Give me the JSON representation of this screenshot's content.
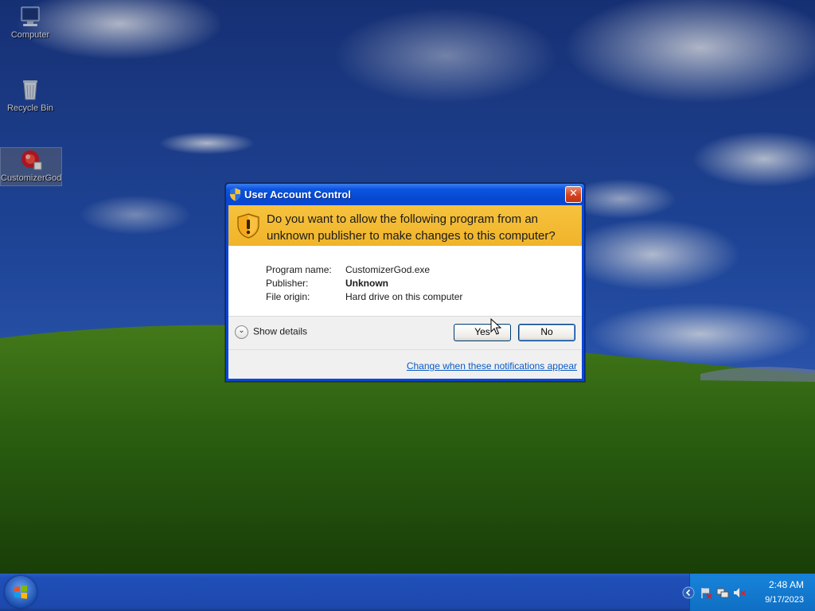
{
  "desktop": {
    "icons": [
      {
        "label": "Computer",
        "icon": "computer-icon"
      },
      {
        "label": "Recycle Bin",
        "icon": "recycle-bin-icon"
      },
      {
        "label": "CustomizerGod",
        "icon": "customizergod-app-icon",
        "selected": true
      }
    ]
  },
  "dialog": {
    "title": "User Account Control",
    "close_label": "✕",
    "question": "Do you want to allow the following program from an unknown publisher to make changes to this computer?",
    "details": [
      {
        "key": "Program name:",
        "value": "CustomizerGod.exe",
        "bold": false
      },
      {
        "key": "Publisher:",
        "value": "Unknown",
        "bold": true
      },
      {
        "key": "File origin:",
        "value": "Hard drive on this computer",
        "bold": false
      }
    ],
    "show_details_label": "Show details",
    "yes_label": "Yes",
    "no_label": "No",
    "link_text": "Change when these notifications appear"
  },
  "taskbar": {
    "start_icon": "windows-start-orb",
    "tray_icons": [
      "show-hidden-icons-chevron",
      "action-center-flag-icon",
      "network-icon",
      "volume-muted-icon"
    ],
    "time": "2:48 AM",
    "date": "9/17/2023"
  },
  "colors": {
    "banner": "#f0b429",
    "titlebar": "#0747d2",
    "link": "#0a5bc4",
    "close": "#d2421d"
  }
}
